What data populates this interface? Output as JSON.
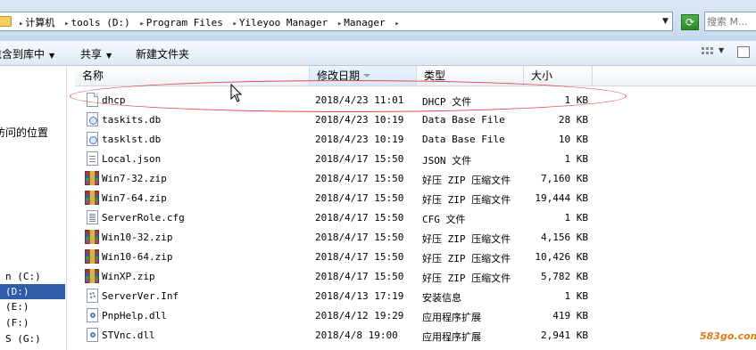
{
  "address_bar": {
    "crumbs": [
      "计算机",
      "tools (D:)",
      "Program Files",
      "Yileyoo Manager",
      "Manager"
    ],
    "search_placeholder": "搜索 M..."
  },
  "toolbar": {
    "include_in_library": "包含到库中",
    "share": "共享",
    "new_folder": "新建文件夹"
  },
  "nav_pane": {
    "text": "访问的位置",
    "drives": [
      {
        "label": "n (C:)",
        "selected": false
      },
      {
        "label": "(D:)",
        "selected": true
      },
      {
        "label": "(E:)",
        "selected": false
      },
      {
        "label": "(F:)",
        "selected": false
      },
      {
        "label": "S (G:)",
        "selected": false
      }
    ]
  },
  "columns": {
    "name": "名称",
    "date": "修改日期",
    "type": "类型",
    "size": "大小"
  },
  "files": [
    {
      "name": "dhcp",
      "date": "2018/4/23 11:01",
      "type": "DHCP 文件",
      "size": "1 KB",
      "icon": "doc"
    },
    {
      "name": "taskits.db",
      "date": "2018/4/23 10:19",
      "type": "Data Base File",
      "size": "28 KB",
      "icon": "db"
    },
    {
      "name": "tasklst.db",
      "date": "2018/4/23 10:19",
      "type": "Data Base File",
      "size": "10 KB",
      "icon": "db"
    },
    {
      "name": "Local.json",
      "date": "2018/4/17 15:50",
      "type": "JSON 文件",
      "size": "1 KB",
      "icon": "json"
    },
    {
      "name": "Win7-32.zip",
      "date": "2018/4/17 15:50",
      "type": "好压 ZIP 压缩文件",
      "size": "7,160 KB",
      "icon": "zip"
    },
    {
      "name": "Win7-64.zip",
      "date": "2018/4/17 15:50",
      "type": "好压 ZIP 压缩文件",
      "size": "19,444 KB",
      "icon": "zip"
    },
    {
      "name": "ServerRole.cfg",
      "date": "2018/4/17 15:50",
      "type": "CFG 文件",
      "size": "1 KB",
      "icon": "cfg"
    },
    {
      "name": "Win10-32.zip",
      "date": "2018/4/17 15:50",
      "type": "好压 ZIP 压缩文件",
      "size": "4,156 KB",
      "icon": "zip"
    },
    {
      "name": "Win10-64.zip",
      "date": "2018/4/17 15:50",
      "type": "好压 ZIP 压缩文件",
      "size": "10,426 KB",
      "icon": "zip"
    },
    {
      "name": "WinXP.zip",
      "date": "2018/4/17 15:50",
      "type": "好压 ZIP 压缩文件",
      "size": "5,782 KB",
      "icon": "zip"
    },
    {
      "name": "ServerVer.Inf",
      "date": "2018/4/13 17:19",
      "type": "安装信息",
      "size": "1 KB",
      "icon": "inf"
    },
    {
      "name": "PnpHelp.dll",
      "date": "2018/4/12 19:29",
      "type": "应用程序扩展",
      "size": "419 KB",
      "icon": "dll"
    },
    {
      "name": "STVnc.dll",
      "date": "2018/4/8 19:00",
      "type": "应用程序扩展",
      "size": "2,941 KB",
      "icon": "dll"
    }
  ],
  "watermark": "583go.com",
  "colors": {
    "selection": "#2f5ca8",
    "annotation": "#e04848",
    "watermark": "#e07a10"
  }
}
